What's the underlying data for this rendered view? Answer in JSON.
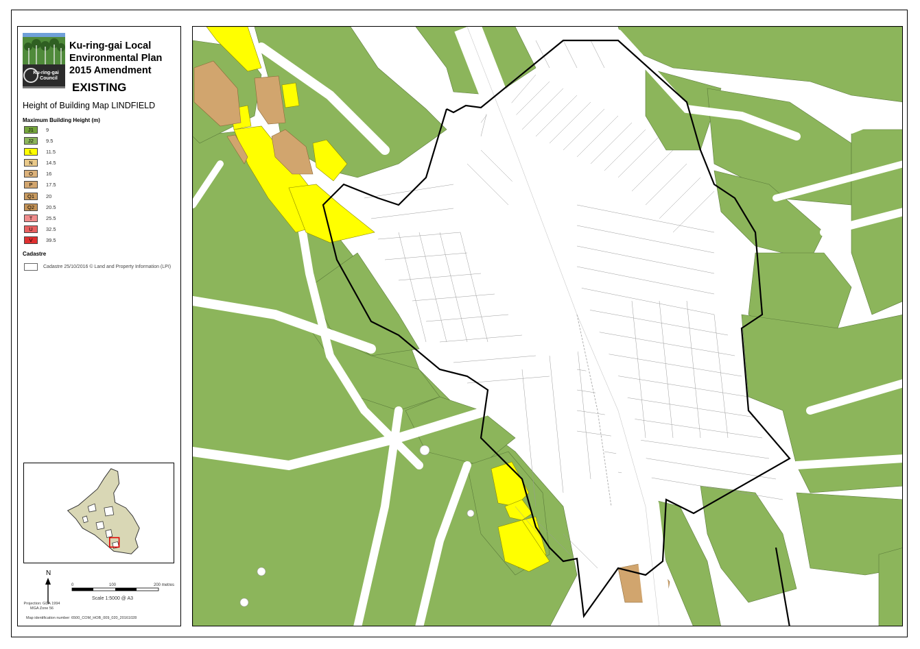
{
  "title": {
    "lines": [
      "Ku-ring-gai Local",
      "Environmental Plan",
      "2015 Amendment"
    ],
    "status": "EXISTING"
  },
  "logo": {
    "text_line1": "Ku-ring-gai",
    "text_line2": "Council"
  },
  "map_name": "Height of Building Map LINDFIELD",
  "legend": {
    "heading": "Maximum Building Height (m)",
    "items": [
      {
        "code": "J1",
        "value": "9",
        "color": "#74a53b"
      },
      {
        "code": "J2",
        "value": "9.5",
        "color": "#8cb55b"
      },
      {
        "code": "L",
        "value": "11.5",
        "color": "#ffff00"
      },
      {
        "code": "N",
        "value": "14.5",
        "color": "#e9c98a"
      },
      {
        "code": "O",
        "value": "16",
        "color": "#dcb27b"
      },
      {
        "code": "P",
        "value": "17.5",
        "color": "#d1a56e"
      },
      {
        "code": "Q1",
        "value": "20",
        "color": "#c89a5f"
      },
      {
        "code": "Q2",
        "value": "20.5",
        "color": "#c39256"
      },
      {
        "code": "T",
        "value": "25.5",
        "color": "#f08c8c"
      },
      {
        "code": "U",
        "value": "32.5",
        "color": "#e86060"
      },
      {
        "code": "V",
        "value": "39.5",
        "color": "#e03030"
      }
    ]
  },
  "cadastre": {
    "heading": "Cadastre",
    "text": "Cadastre 25/10/2016 © Land and Property Information (LPI)"
  },
  "north_label": "N",
  "scale": {
    "ticks": [
      "0",
      "100",
      "200 metres"
    ],
    "text": "Scale   1:5000   @ A3"
  },
  "projection": [
    "Projection: GDA 1994",
    "MGA Zone 56"
  ],
  "map_id": "Map identification number:   6500_COM_HOB_009_020_20161028",
  "colors": {
    "zone_green": "#8cb55b",
    "zone_yellow": "#ffff00",
    "zone_tan": "#d1a56e",
    "boundary": "#000000"
  }
}
